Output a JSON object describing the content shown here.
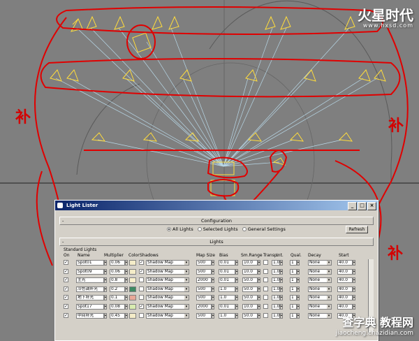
{
  "brand": {
    "name": "火星时代",
    "url": "www.hxsd.com"
  },
  "watermark": {
    "name": "查字典 教程网",
    "url": "jiaocheng.chazidian.com"
  },
  "annotations": [
    "补",
    "补",
    "补"
  ],
  "dialog": {
    "title": "Light Lister",
    "configuration_label": "Configuration",
    "radio_options": [
      {
        "label": "All Lights",
        "selected": true
      },
      {
        "label": "Selected Lights",
        "selected": false
      },
      {
        "label": "General Settings",
        "selected": false
      }
    ],
    "refresh_label": "Refresh",
    "lights_label": "Lights",
    "group_label": "Standard Lights",
    "columns": [
      "On",
      "Name",
      "Multiplier",
      "Color",
      "Shadows",
      "Map Size",
      "Bias",
      "Sm.Range",
      "Transp.",
      "Int.",
      "Qual.",
      "Decay",
      "Start"
    ],
    "rows": [
      {
        "on": true,
        "name": "Spot01",
        "multiplier": "0.06",
        "color": "#f4ecc8",
        "shadow_on": true,
        "shadow": "Shadow Map",
        "map_size": "500",
        "bias": "0.01",
        "sm_range": "10.0",
        "transp": false,
        "int": "1.0",
        "qual": "1",
        "decay": "None",
        "start": "40.0"
      },
      {
        "on": true,
        "name": "Spot09",
        "multiplier": "0.06",
        "color": "#f4ecc8",
        "shadow_on": true,
        "shadow": "Shadow Map",
        "map_size": "500",
        "bias": "0.01",
        "sm_range": "10.0",
        "transp": false,
        "int": "1.0",
        "qual": "1",
        "decay": "None",
        "start": "40.0"
      },
      {
        "on": true,
        "name": "主光",
        "multiplier": "0.8",
        "color": "#f8f0cc",
        "shadow_on": false,
        "shadow": "Shadow Map",
        "map_size": "2000",
        "bias": "0.01",
        "sm_range": "50.0",
        "transp": false,
        "int": "1.0",
        "qual": "1",
        "decay": "None",
        "start": "40.0"
      },
      {
        "on": true,
        "name": "冷色调补光",
        "multiplier": "0.2",
        "color": "#3e8a63",
        "shadow_on": false,
        "shadow": "Shadow Map",
        "map_size": "500",
        "bias": "1.0",
        "sm_range": "50.0",
        "transp": false,
        "int": "1.0",
        "qual": "1",
        "decay": "None",
        "start": "40.0"
      },
      {
        "on": true,
        "name": "地下补光",
        "multiplier": "0.1",
        "color": "#e8a898",
        "shadow_on": false,
        "shadow": "Shadow Map",
        "map_size": "500",
        "bias": "1.0",
        "sm_range": "50.0",
        "transp": false,
        "int": "1.0",
        "qual": "1",
        "decay": "None",
        "start": "40.0"
      },
      {
        "on": true,
        "name": "Spot17",
        "multiplier": "0.08",
        "color": "#d8ecb0",
        "shadow_on": true,
        "shadow": "Shadow Map",
        "map_size": "2000",
        "bias": "0.01",
        "sm_range": "10.0",
        "transp": false,
        "int": "1.0",
        "qual": "1",
        "decay": "None",
        "start": "40.0"
      },
      {
        "on": true,
        "name": "中间补光",
        "multiplier": "0.45",
        "color": "#f4ecc8",
        "shadow_on": false,
        "shadow": "Shadow Map",
        "map_size": "500",
        "bias": "1.0",
        "sm_range": "50.0",
        "transp": false,
        "int": "1.0",
        "qual": "1",
        "decay": "None",
        "start": "40.0"
      }
    ]
  }
}
